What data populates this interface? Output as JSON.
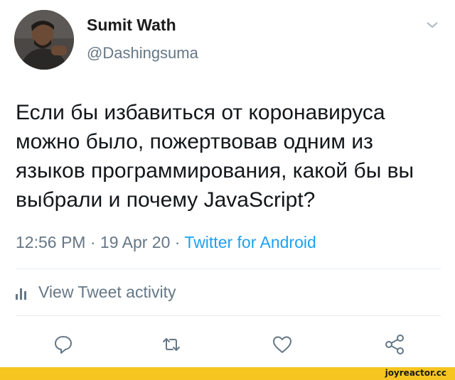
{
  "tweet": {
    "author_name": "Sumit Wath",
    "author_handle": "@Dashingsuma",
    "text_lines": [
      "Если бы избавиться от коронавируса",
      "можно было, пожертвовав одним из",
      "языков программирования, какой бы вы",
      "выбрали и почему JavaScript?"
    ],
    "time": "12:56 PM",
    "date": "19 Apr 20",
    "source": "Twitter for Android",
    "separator": "·",
    "activity_label": "View Tweet activity"
  },
  "icons": {
    "menu": "chevron-down-icon",
    "activity": "bar-chart-icon",
    "reply": "comment-icon",
    "retweet": "retweet-icon",
    "like": "heart-icon",
    "share": "share-icon"
  },
  "watermark": {
    "text": "joyreactor.cc",
    "color": "#f7c520"
  },
  "colors": {
    "accent": "#1da1f2",
    "muted": "#657786"
  }
}
